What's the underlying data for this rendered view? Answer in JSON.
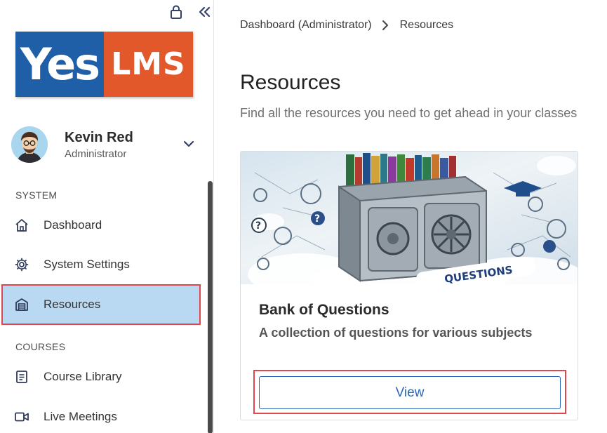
{
  "logo": {
    "left": "Yes",
    "right": "LMS"
  },
  "user": {
    "name": "Kevin Red",
    "role": "Administrator"
  },
  "sidebar": {
    "sections": [
      {
        "label": "SYSTEM"
      },
      {
        "label": "COURSES"
      }
    ],
    "items": [
      {
        "label": "Dashboard",
        "icon": "home-icon"
      },
      {
        "label": "System Settings",
        "icon": "gear-icon"
      },
      {
        "label": "Resources",
        "icon": "archive-icon",
        "active": true
      },
      {
        "label": "Course Library",
        "icon": "document-icon"
      },
      {
        "label": "Live Meetings",
        "icon": "video-icon"
      }
    ]
  },
  "breadcrumb": {
    "parent": "Dashboard (Administrator)",
    "current": "Resources"
  },
  "page": {
    "title": "Resources",
    "subtitle": "Find all the resources you need to get ahead in your classes"
  },
  "card": {
    "image_banner": "QUESTIONS",
    "title": "Bank of Questions",
    "description": "A collection of questions for various subjects",
    "button_label": "View"
  },
  "colors": {
    "brand_blue": "#1f5fa8",
    "brand_orange": "#e2582a",
    "active_bg": "#b9d9f3",
    "highlight_red": "#e0474c",
    "button_blue": "#2a68b8"
  }
}
